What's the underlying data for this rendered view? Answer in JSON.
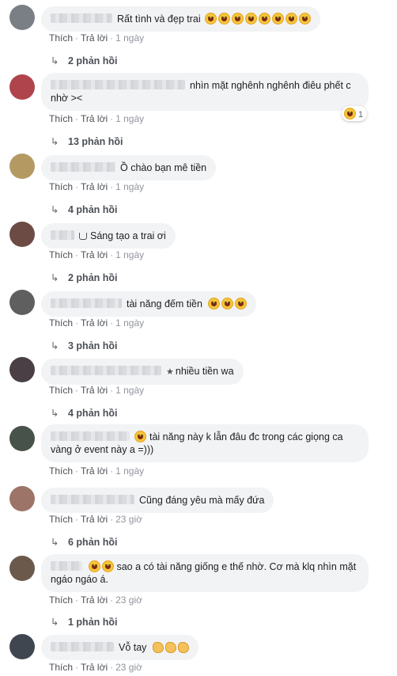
{
  "comments": [
    {
      "text": "Rất tình và đẹp trai",
      "emoji_count": 8,
      "emoji": "laughing-tears",
      "like": "Thích",
      "reply": "Trả lời",
      "time": "1 ngày",
      "replies": "2 phản hồi",
      "avatar_color": "#7a7f86"
    },
    {
      "text": "nhìn mặt nghênh nghênh điêu phết c nhờ ><",
      "like": "Thích",
      "reply": "Trả lời",
      "time": "1 ngày",
      "replies": "13 phản hồi",
      "reaction_count": "1",
      "avatar_color": "#b0444c"
    },
    {
      "text": "Ồ chào bạn mê tiền",
      "like": "Thích",
      "reply": "Trả lời",
      "time": "1 ngày",
      "replies": "4 phản hồi",
      "avatar_color": "#b49a62"
    },
    {
      "text": "Sáng tạo a trai ơi",
      "like": "Thích",
      "reply": "Trả lời",
      "time": "1 ngày",
      "replies": "2 phản hồi",
      "avatar_color": "#6b4b44"
    },
    {
      "text": "tài năng đếm tiền",
      "emoji_count": 3,
      "emoji": "grinning",
      "like": "Thích",
      "reply": "Trả lời",
      "time": "1 ngày",
      "replies": "3 phản hồi",
      "avatar_color": "#5f5f5f"
    },
    {
      "text": "nhiều tiền wa",
      "like": "Thích",
      "reply": "Trả lời",
      "time": "1 ngày",
      "replies": "4 phản hồi",
      "avatar_color": "#4a3f44"
    },
    {
      "text": "tài năng này k lẫn đâu đc trong các giọng ca vàng ở event này a =)))",
      "like": "Thích",
      "reply": "Trả lời",
      "time": "1 ngày",
      "replies": "",
      "avatar_color": "#47534a"
    },
    {
      "text": "Cũng đáng yêu mà mấy đứa",
      "like": "Thích",
      "reply": "Trả lời",
      "time": "23 giờ",
      "replies": "6 phản hồi",
      "avatar_color": "#9c7468"
    },
    {
      "text": "sao a có tài năng giống e thế nhờ. Cơ mà klq nhìn mặt ngáo ngáo á.",
      "like": "Thích",
      "reply": "Trả lời",
      "time": "23 giờ",
      "replies": "1 phản hồi",
      "avatar_color": "#6b5a4c"
    },
    {
      "text": "Vỗ tay",
      "like": "Thích",
      "reply": "Trả lời",
      "time": "23 giờ",
      "replies": "",
      "avatar_color": "#3f4650"
    }
  ],
  "colors": {
    "bubble": "#f2f3f5",
    "meta": "#90949c",
    "reply_link": "#4b4f56"
  }
}
